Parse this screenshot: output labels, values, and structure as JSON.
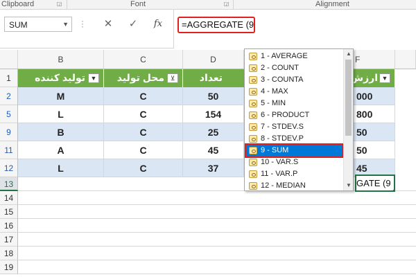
{
  "ribbon": {
    "groups": [
      "Clipboard",
      "Font",
      "Alignment"
    ]
  },
  "namebox": {
    "value": "SUM"
  },
  "formula_bar": {
    "cancel_icon": "✕",
    "enter_icon": "✓",
    "fx_label": "fx",
    "formula": "=AGGREGATE (9"
  },
  "columns": [
    "B",
    "C",
    "D",
    "F"
  ],
  "header_row": {
    "row_number": "1",
    "cells": [
      "تولید کننده",
      "محل تولید",
      "تعداد",
      "ارزش"
    ]
  },
  "rows": [
    {
      "row_number": "2",
      "values": [
        "M",
        "C",
        "50",
        "000"
      ]
    },
    {
      "row_number": "5",
      "values": [
        "L",
        "C",
        "154",
        "800"
      ]
    },
    {
      "row_number": "9",
      "values": [
        "B",
        "C",
        "25",
        "50"
      ]
    },
    {
      "row_number": "11",
      "values": [
        "A",
        "C",
        "45",
        "50"
      ]
    },
    {
      "row_number": "12",
      "values": [
        "L",
        "C",
        "37",
        "45"
      ]
    }
  ],
  "extra_rows": [
    "13",
    "14",
    "15",
    "16",
    "17",
    "18",
    "19"
  ],
  "active_cell_text": "GATE (9",
  "autocomplete": {
    "items": [
      "1 - AVERAGE",
      "2 - COUNT",
      "3 - COUNTA",
      "4 - MAX",
      "5 - MIN",
      "6 - PRODUCT",
      "7 - STDEV.S",
      "8 - STDEV.P",
      "9 - SUM",
      "10 - VAR.S",
      "11 - VAR.P",
      "12 - MEDIAN"
    ],
    "selected": "9 - SUM"
  },
  "colors": {
    "header_green": "#70ad47",
    "band_blue": "#dbe6f4",
    "highlight_red": "#e0201e",
    "selection_blue": "#0078d7"
  }
}
